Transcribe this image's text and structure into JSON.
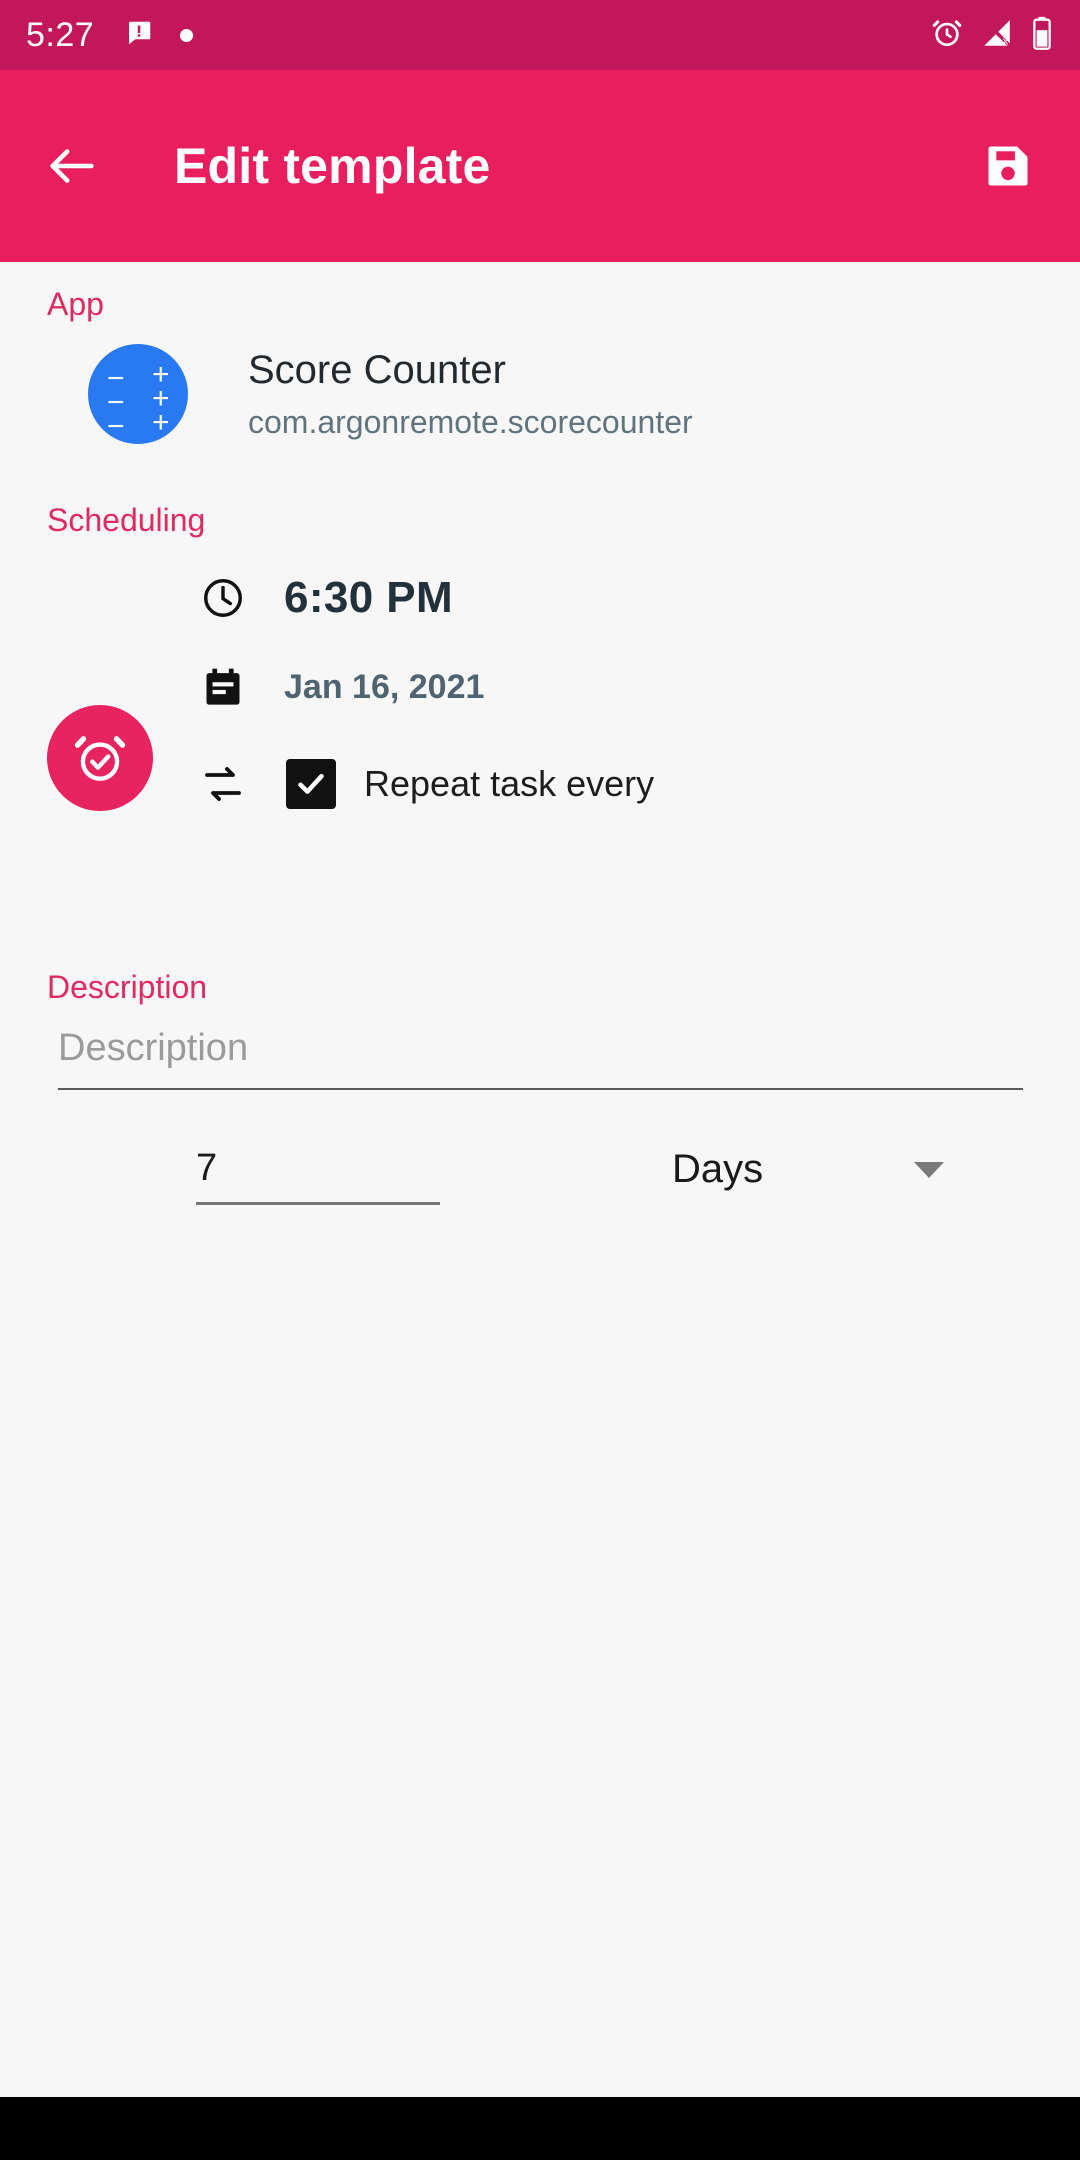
{
  "status_bar": {
    "time": "5:27",
    "icons_left": [
      "message-icon",
      "dot-indicator"
    ],
    "icons_right": [
      "alarm-icon",
      "signal-off-icon",
      "battery-icon"
    ],
    "background": "#C2185B"
  },
  "app_bar": {
    "title": "Edit template",
    "back_icon": "arrow-back-icon",
    "save_icon": "save-floppy-icon",
    "background": "#E81E5E"
  },
  "sections": {
    "app": {
      "label": "App",
      "app_name": "Score Counter",
      "package_name": "com.argonremote.scorecounter",
      "icon_color": "#2979F2"
    },
    "scheduling": {
      "label": "Scheduling",
      "alarm_badge_color": "#E8245F",
      "time": "6:30 PM",
      "date": "Jan 16, 2021",
      "repeat_label": "Repeat task every",
      "repeat_checked": true,
      "interval_value": "7",
      "interval_unit": "Days"
    },
    "description": {
      "label": "Description",
      "placeholder": "Description",
      "value": ""
    }
  },
  "theme": {
    "accent": "#E02A62",
    "page_background": "#F7F7F7"
  }
}
